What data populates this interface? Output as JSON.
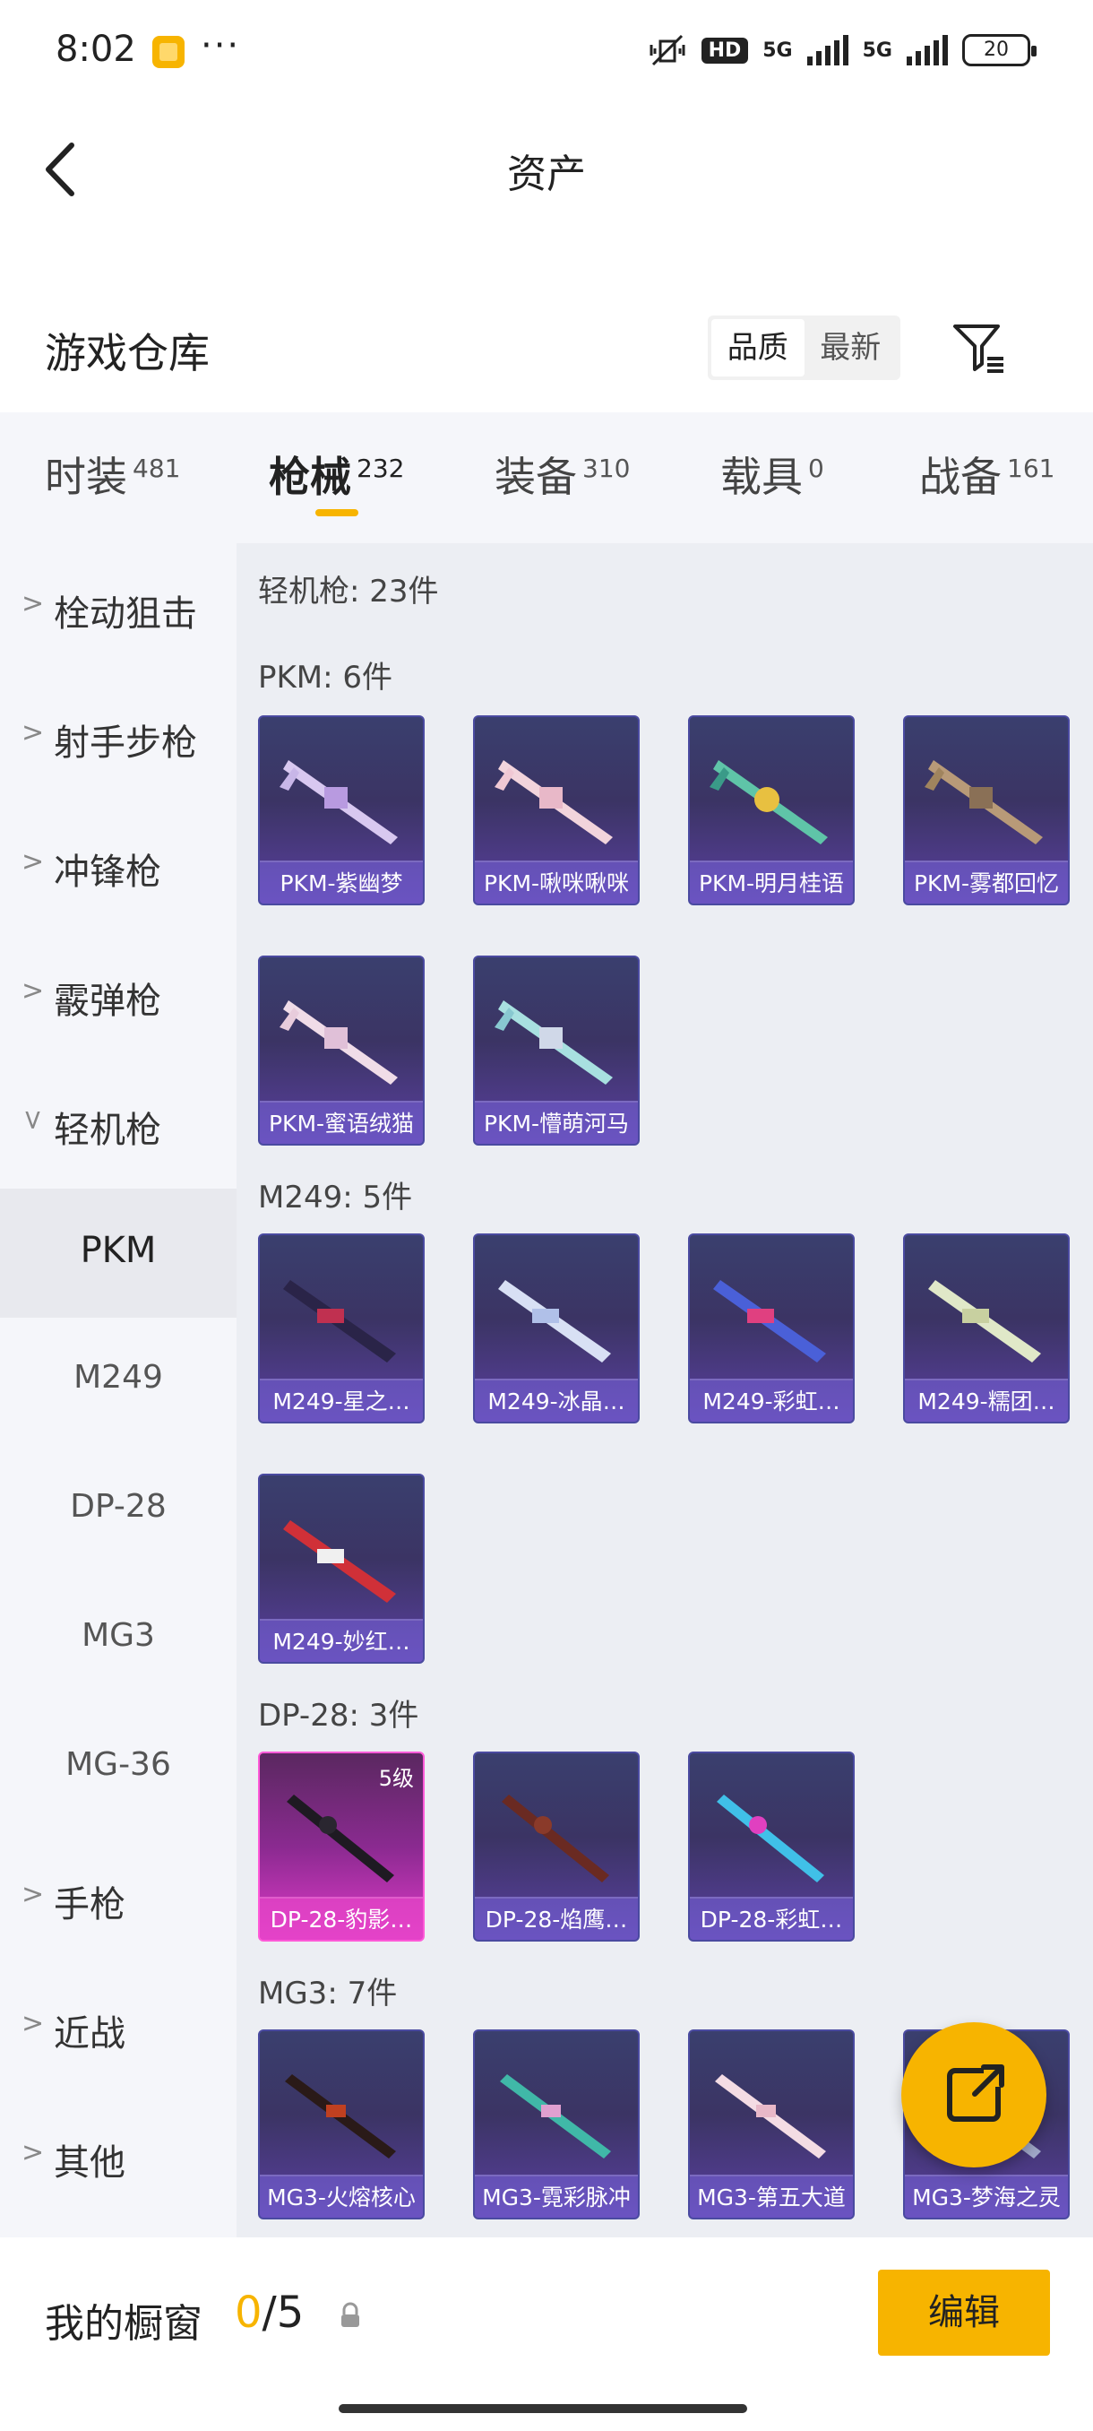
{
  "status_bar": {
    "time": "8:02",
    "more": "···",
    "hd_badge": "HD",
    "net1": "5G",
    "net2": "5G",
    "battery": "20"
  },
  "header": {
    "title": "资产"
  },
  "warehouse": {
    "title": "游戏仓库",
    "sort_options": [
      "品质",
      "最新"
    ],
    "sort_active": "品质"
  },
  "tabs": [
    {
      "label": "时装",
      "count": "481"
    },
    {
      "label": "枪械",
      "count": "232"
    },
    {
      "label": "装备",
      "count": "310"
    },
    {
      "label": "载具",
      "count": "0"
    },
    {
      "label": "战备",
      "count": "161"
    }
  ],
  "active_tab": "枪械",
  "sidebar": {
    "items": [
      "栓动狙击",
      "射手步枪",
      "冲锋枪",
      "霰弹枪",
      "轻机枪"
    ],
    "subitems": [
      "PKM",
      "M249",
      "DP-28",
      "MG3",
      "MG-36"
    ],
    "more_items": [
      "手枪",
      "近战",
      "其他"
    ],
    "selected": "PKM"
  },
  "content": {
    "category_header": "轻机枪: 23件",
    "sections": [
      {
        "title": "PKM: 6件",
        "items": [
          "PKM-紫幽梦",
          "PKM-啾咪啾咪",
          "PKM-明月桂语",
          "PKM-雾都回忆",
          "PKM-蜜语绒猫",
          "PKM-懵萌河马"
        ]
      },
      {
        "title": "M249: 5件",
        "items": [
          "M249-星之…",
          "M249-冰晶…",
          "M249-彩虹…",
          "M249-糯团…",
          "M249-妙红…"
        ]
      },
      {
        "title": "DP-28: 3件",
        "items": [
          "DP-28-豹影…",
          "DP-28-焰鹰…",
          "DP-28-彩虹…"
        ],
        "level_badge": "5级"
      },
      {
        "title": "MG3: 7件",
        "items": [
          "MG3-火熔核心",
          "MG3-霓彩脉冲",
          "MG3-第五大道",
          "MG3-梦海之灵"
        ]
      }
    ]
  },
  "showcase": {
    "label": "我的橱窗",
    "current": "0",
    "total": "/5",
    "edit_label": "编辑"
  },
  "colors": {
    "accent": "#f7b400",
    "card_purple": "#3b3464",
    "card_pink": "#e03ac8",
    "sidebar_bg": "#f5f6fa",
    "content_bg": "#eceef3"
  }
}
